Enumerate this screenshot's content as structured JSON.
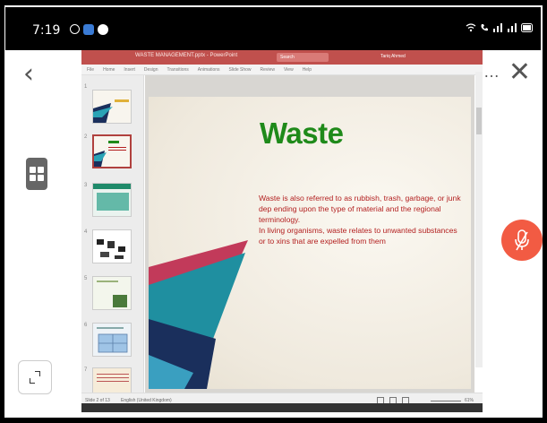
{
  "statusbar": {
    "time": "7:19"
  },
  "ppt": {
    "window_title": "WASTE MANAGEMENT.pptx - PowerPoint",
    "search_placeholder": "Search",
    "user_name": "Tariq Ahmed",
    "menu": [
      "File",
      "Home",
      "Insert",
      "Design",
      "Transitions",
      "Animations",
      "Slide Show",
      "Review",
      "View",
      "Help"
    ],
    "status_slide": "Slide 2 of 13",
    "status_lang": "English (United Kingdom)",
    "zoom": "61%"
  },
  "slide": {
    "title": "Waste",
    "para1": "Waste is also referred to as rubbish, trash, garbage, or junk dep ending upon the type of material and the regional terminology.",
    "para2": "In living organisms, waste relates to unwanted substances or to xins that are expelled from them"
  },
  "thumbnails": [
    "1",
    "2",
    "3",
    "4",
    "5",
    "6",
    "7"
  ],
  "colors": {
    "ppt_accent": "#c0504d",
    "title_green": "#1f8a1a",
    "body_red": "#b32020",
    "mic_button": "#f25b43"
  },
  "icons": [
    "back-arrow-icon",
    "grid-icon",
    "expand-icon",
    "close-icon",
    "more-icon",
    "camera-off-icon",
    "pen-icon",
    "bluetooth-icon",
    "person-list-icon",
    "mic-off-icon"
  ]
}
